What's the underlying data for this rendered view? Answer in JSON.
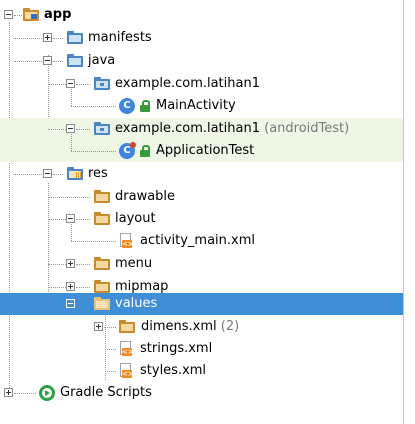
{
  "tree": {
    "app": "app",
    "manifests": "manifests",
    "java": "java",
    "package_main": "example.com.latihan1",
    "main_activity": "MainActivity",
    "package_test": "example.com.latihan1",
    "package_test_suffix": "(androidTest)",
    "application_test": "ApplicationTest",
    "res": "res",
    "drawable": "drawable",
    "layout": "layout",
    "activity_main": "activity_main.xml",
    "menu": "menu",
    "mipmap": "mipmap",
    "values": "values",
    "dimens": "dimens.xml",
    "dimens_count": "(2)",
    "strings": "strings.xml",
    "styles": "styles.xml",
    "gradle_scripts": "Gradle Scripts"
  },
  "icons": {
    "class_letter": "C",
    "xml_badge": "<>"
  },
  "colors": {
    "selection": "#3f8fd8",
    "test_highlight": "#eef6e6"
  }
}
